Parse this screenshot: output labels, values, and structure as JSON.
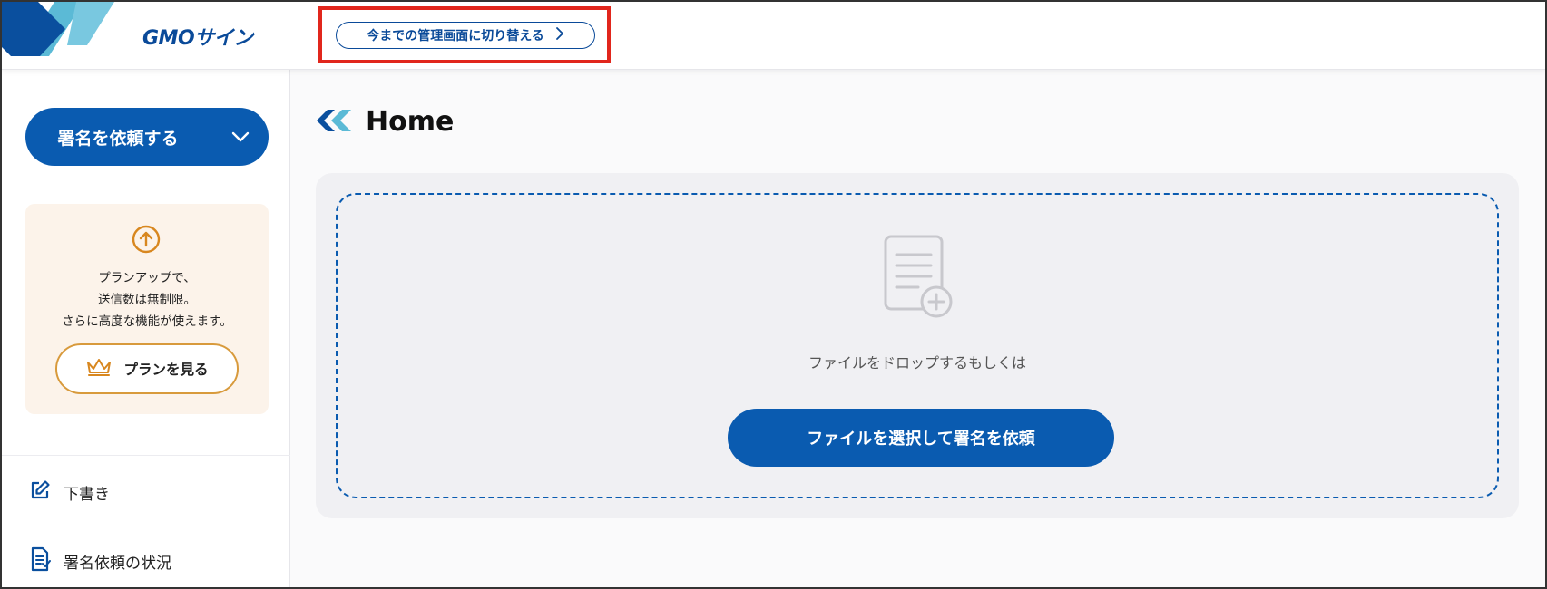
{
  "header": {
    "brand": "GMOサイン",
    "switch_button_label": "今までの管理画面に切り替える"
  },
  "sidebar": {
    "request_button_label": "署名を依頼する",
    "promo": {
      "line1": "プランアップで、",
      "line2": "送信数は無制限。",
      "line3": "さらに高度な機能が使えます。",
      "plan_button_label": "プランを見る"
    },
    "nav": [
      {
        "label": "下書き",
        "icon": "edit-icon"
      },
      {
        "label": "署名依頼の状況",
        "icon": "document-list-icon"
      }
    ]
  },
  "main": {
    "title": "Home",
    "drop_text": "ファイルをドロップするもしくは",
    "select_button_label": "ファイルを選択して署名を依頼"
  },
  "colors": {
    "brand_blue": "#0a5bb0",
    "highlight_red": "#e1261c",
    "promo_bg": "#fcf3ea",
    "promo_accent": "#d89a3c"
  }
}
